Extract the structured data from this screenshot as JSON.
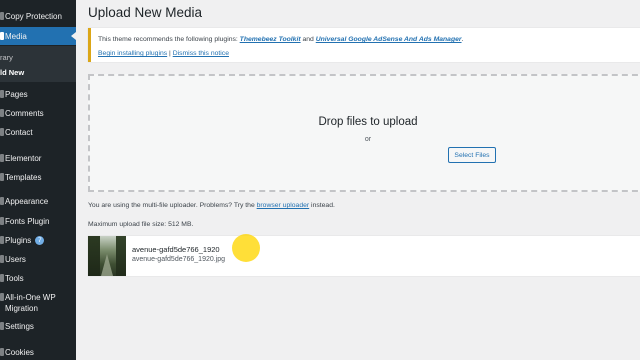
{
  "sidebar": {
    "items": [
      {
        "label": "Copy Protection",
        "icon": "shield-icon"
      },
      {
        "label": "Media",
        "icon": "media-icon"
      },
      {
        "label": "Pages",
        "icon": "pages-icon"
      },
      {
        "label": "Comments",
        "icon": "comments-icon"
      },
      {
        "label": "Contact",
        "icon": "contact-icon"
      },
      {
        "label": "Elementor",
        "icon": "elementor-icon"
      },
      {
        "label": "Templates",
        "icon": "templates-icon"
      },
      {
        "label": "Appearance",
        "icon": "appearance-icon"
      },
      {
        "label": "Fonts Plugin",
        "icon": "fonts-icon"
      },
      {
        "label": "Plugins",
        "icon": "plugins-icon",
        "badge": "7"
      },
      {
        "label": "Users",
        "icon": "users-icon"
      },
      {
        "label": "Tools",
        "icon": "tools-icon"
      },
      {
        "label": "All-in-One WP Migration",
        "icon": "migration-icon"
      },
      {
        "label": "Settings",
        "icon": "settings-icon"
      },
      {
        "label": "Cookies",
        "icon": "cookies-icon"
      }
    ],
    "submenu": [
      {
        "label": "rary"
      },
      {
        "label": "ld New"
      }
    ]
  },
  "page": {
    "title": "Upload New Media"
  },
  "notice": {
    "text_before": "This theme recommends the following plugins: ",
    "plugin1": "Themebeez Toolkit",
    "text_and": " and ",
    "plugin2": "Universal Google AdSense And Ads Manager",
    "text_end": ".",
    "begin_link": "Begin installing plugins",
    "separator": " | ",
    "dismiss_link": "Dismiss this notice"
  },
  "upload": {
    "drop_text": "Drop files to upload",
    "or_text": "or",
    "select_button": "Select Files",
    "info_before": "You are using the multi-file uploader. Problems? Try the ",
    "browser_uploader_link": "browser uploader",
    "info_after": " instead.",
    "max_size": "Maximum upload file size: 512 MB."
  },
  "media_item": {
    "title": "avenue-gafd5de766_1920",
    "filename": "avenue-gafd5de766_1920.jpg"
  },
  "colors": {
    "sidebar_bg": "#1d2327",
    "accent": "#2271b1",
    "notice_border": "#dba617",
    "cursor_highlight": "#ffd600"
  }
}
